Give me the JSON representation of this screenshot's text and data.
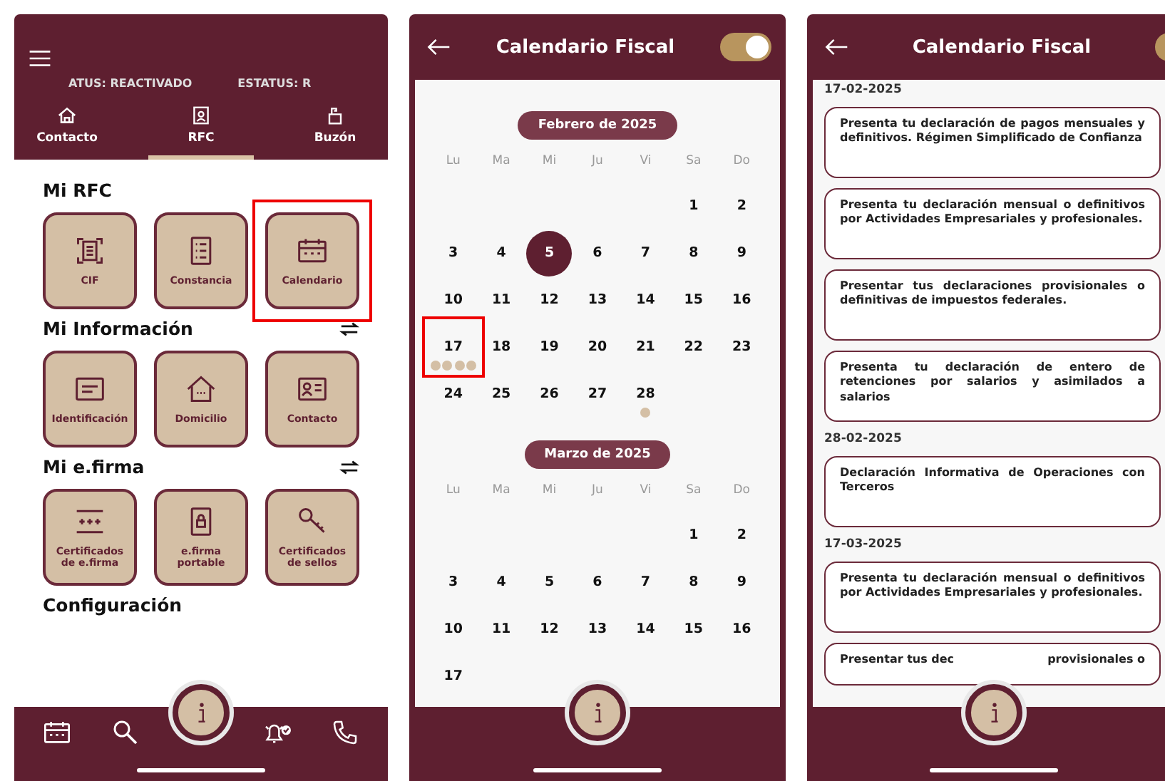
{
  "home_screen": {
    "status_labels": [
      "ATUS: REACTIVADO",
      "ESTATUS: R"
    ],
    "tabs": [
      {
        "label": "Contacto",
        "selected": false
      },
      {
        "label": "RFC",
        "selected": true
      },
      {
        "label": "Buzón",
        "selected": false
      }
    ],
    "sections": [
      {
        "title": "Mi RFC",
        "swap": false,
        "tiles": [
          {
            "label": "CIF",
            "highlighted": false
          },
          {
            "label": "Constancia",
            "highlighted": false
          },
          {
            "label": "Calendario",
            "highlighted": true
          }
        ]
      },
      {
        "title": "Mi Información",
        "swap": true,
        "tiles": [
          {
            "label": "Identificación",
            "highlighted": false
          },
          {
            "label": "Domicilio",
            "highlighted": false
          },
          {
            "label": "Contacto",
            "highlighted": false
          }
        ]
      },
      {
        "title": "Mi e.firma",
        "swap": true,
        "tiles": [
          {
            "label": "Certificados de e.firma",
            "highlighted": false
          },
          {
            "label": "e.firma portable",
            "highlighted": false
          },
          {
            "label": "Certificados de sellos",
            "highlighted": false
          }
        ]
      },
      {
        "title": "Configuración",
        "swap": false
      }
    ]
  },
  "calendar_screen": {
    "title": "Calendario Fiscal",
    "toggle_on": true,
    "months": [
      {
        "label": "Febrero de 2025",
        "weekdays": [
          "Lu",
          "Ma",
          "Mi",
          "Ju",
          "Vi",
          "Sa",
          "Do"
        ],
        "weeks": [
          [
            {
              "day": "1",
              "selected": false,
              "highlighted": false
            },
            {
              "day": "2",
              "selected": false,
              "highlighted": false
            }
          ],
          [
            {
              "day": "3",
              "selected": false,
              "highlighted": false
            },
            {
              "day": "4",
              "selected": false,
              "highlighted": false
            },
            {
              "day": "5",
              "selected": true,
              "highlighted": false
            },
            {
              "day": "6",
              "selected": false,
              "highlighted": false
            },
            {
              "day": "7",
              "selected": false,
              "highlighted": false
            },
            {
              "day": "8",
              "selected": false,
              "highlighted": false
            },
            {
              "day": "9",
              "selected": false,
              "highlighted": false
            }
          ],
          [
            {
              "day": "10",
              "selected": false,
              "highlighted": false
            },
            {
              "day": "11",
              "selected": false,
              "highlighted": false
            },
            {
              "day": "12",
              "selected": false,
              "highlighted": false
            },
            {
              "day": "13",
              "selected": false,
              "highlighted": false
            },
            {
              "day": "14",
              "selected": false,
              "highlighted": false
            },
            {
              "day": "15",
              "selected": false,
              "highlighted": false
            },
            {
              "day": "16",
              "selected": false,
              "highlighted": false
            }
          ],
          [
            {
              "day": "17",
              "selected": false,
              "highlighted": true,
              "markers": [
                {
                  "color": "#d4bfa5"
                },
                {
                  "color": "#d4bfa5"
                },
                {
                  "color": "#d4bfa5"
                },
                {
                  "color": "#d4bfa5"
                }
              ]
            },
            {
              "day": "18",
              "selected": false,
              "highlighted": false
            },
            {
              "day": "19",
              "selected": false,
              "highlighted": false
            },
            {
              "day": "20",
              "selected": false,
              "highlighted": false
            },
            {
              "day": "21",
              "selected": false,
              "highlighted": false
            },
            {
              "day": "22",
              "selected": false,
              "highlighted": false
            },
            {
              "day": "23",
              "selected": false,
              "highlighted": false
            }
          ],
          [
            {
              "day": "24",
              "selected": false,
              "highlighted": false
            },
            {
              "day": "25",
              "selected": false,
              "highlighted": false
            },
            {
              "day": "26",
              "selected": false,
              "highlighted": false
            },
            {
              "day": "27",
              "selected": false,
              "highlighted": false
            },
            {
              "day": "28",
              "selected": false,
              "highlighted": false,
              "markers": [
                {
                  "color": "#d4bfa5"
                }
              ]
            }
          ]
        ]
      },
      {
        "label": "Marzo de 2025",
        "weekdays": [
          "Lu",
          "Ma",
          "Mi",
          "Ju",
          "Vi",
          "Sa",
          "Do"
        ],
        "weeks": [
          [
            {
              "day": "1",
              "selected": false,
              "highlighted": false
            },
            {
              "day": "2",
              "selected": false,
              "highlighted": false
            }
          ],
          [
            {
              "day": "3",
              "selected": false,
              "highlighted": false
            },
            {
              "day": "4",
              "selected": false,
              "highlighted": false
            },
            {
              "day": "5",
              "selected": false,
              "highlighted": false
            },
            {
              "day": "6",
              "selected": false,
              "highlighted": false
            },
            {
              "day": "7",
              "selected": false,
              "highlighted": false
            },
            {
              "day": "8",
              "selected": false,
              "highlighted": false
            },
            {
              "day": "9",
              "selected": false,
              "highlighted": false
            }
          ],
          [
            {
              "day": "10",
              "selected": false,
              "highlighted": false
            },
            {
              "day": "11",
              "selected": false,
              "highlighted": false
            },
            {
              "day": "12",
              "selected": false,
              "highlighted": false
            },
            {
              "day": "13",
              "selected": false,
              "highlighted": false
            },
            {
              "day": "14",
              "selected": false,
              "highlighted": false
            },
            {
              "day": "15",
              "selected": false,
              "highlighted": false
            },
            {
              "day": "16",
              "selected": false,
              "highlighted": false
            }
          ],
          [
            {
              "day": "17",
              "selected": false,
              "highlighted": false
            }
          ]
        ]
      }
    ]
  },
  "events_screen": {
    "title": "Calendario Fiscal",
    "toggle_on": true,
    "groups": [
      {
        "date": "17-02-2025",
        "events": [
          {
            "kind": "full",
            "text": "Presenta tu declaración de pagos mensuales y definitivos. Régimen Simplificado de Confianza"
          },
          {
            "kind": "full",
            "text": "Presenta tu declaración mensual o definitivos por Actividades Empresariales y profesionales."
          },
          {
            "kind": "full",
            "text": "Presentar tus declaraciones provisionales o definitivas de impuestos federales."
          },
          {
            "kind": "full",
            "text": "Presenta tu declaración de entero de retenciones por salarios y asimilados a salarios"
          }
        ]
      },
      {
        "date": "28-02-2025",
        "events": [
          {
            "kind": "full",
            "text": "Declaración Informativa de Operaciones con Terceros"
          }
        ]
      },
      {
        "date": "17-03-2025",
        "events": [
          {
            "kind": "full",
            "text": "Presenta tu declaración mensual o definitivos por Actividades Empresariales y profesionales."
          },
          {
            "kind": "partial",
            "parts": [
              "Presentar tus dec",
              "provisionales o"
            ]
          }
        ]
      }
    ]
  }
}
